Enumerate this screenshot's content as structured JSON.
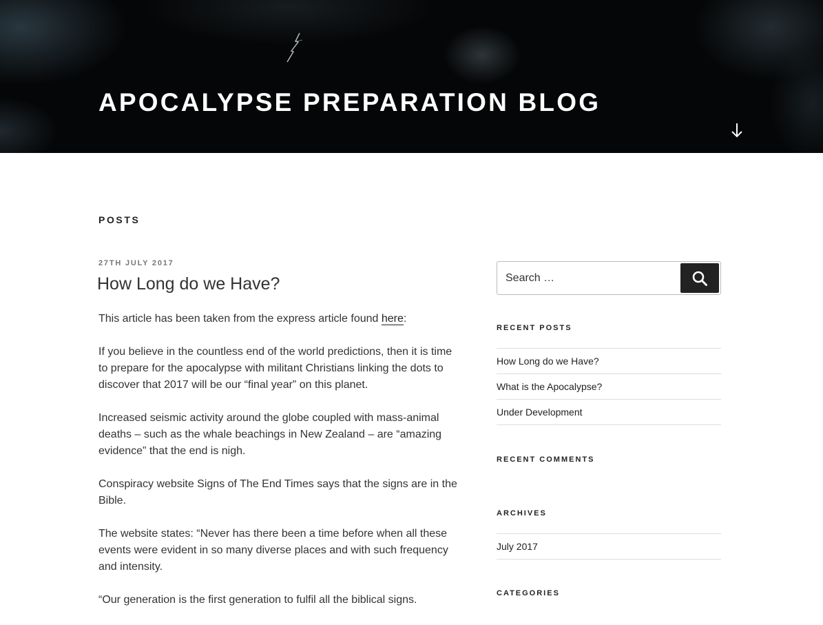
{
  "header": {
    "site_title": "Apocalypse Preparation Blog"
  },
  "page": {
    "heading": "Posts"
  },
  "post": {
    "date": "27th July 2017",
    "title": "How Long do we Have?",
    "intro_before_link": "This article has been taken from the express article found ",
    "intro_link": "here",
    "intro_after_link": ":",
    "paragraphs": [
      "If you believe in the countless end of the world predictions, then it is time to prepare for the apocalypse with militant Christians linking the dots to discover that 2017 will be our “final year” on this planet.",
      "Increased seismic activity around the globe coupled with mass-animal deaths – such as the whale beachings in New Zealand – are “amazing evidence” that the end is nigh.",
      "Conspiracy website Signs of The End Times says that the signs are in the Bible.",
      "The website states: “Never has there been a time before when all these events were evident in so many diverse places and with such frequency and intensity.",
      "“Our generation is the first generation to fulfil all the biblical signs."
    ]
  },
  "sidebar": {
    "search": {
      "placeholder": "Search …",
      "button_label": "Search"
    },
    "recent_posts": {
      "title": "Recent Posts",
      "items": [
        "How Long do we Have?",
        "What is the Apocalypse?",
        "Under Development"
      ]
    },
    "recent_comments": {
      "title": "Recent Comments"
    },
    "archives": {
      "title": "Archives",
      "items": [
        "July 2017"
      ]
    },
    "categories": {
      "title": "Categories"
    }
  },
  "icons": {
    "scroll": "arrow-down-icon",
    "search": "search-icon"
  }
}
